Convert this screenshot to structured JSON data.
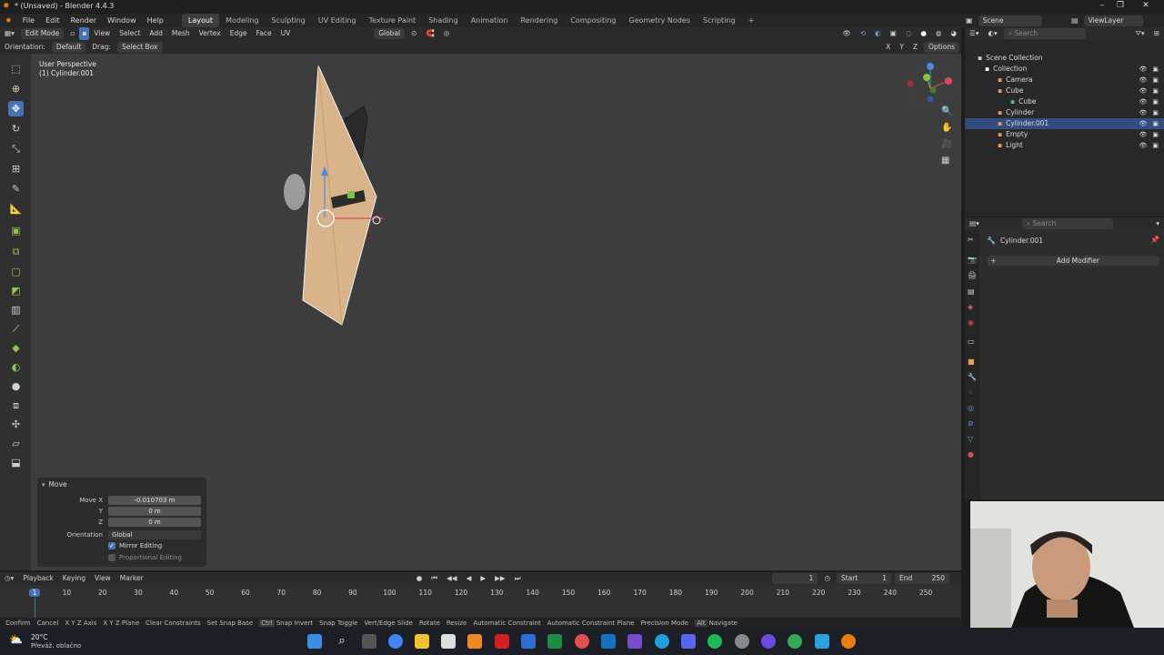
{
  "window": {
    "title": "* (Unsaved) - Blender 4.4.3"
  },
  "menu": [
    "File",
    "Edit",
    "Render",
    "Window",
    "Help"
  ],
  "workspaces": [
    "Layout",
    "Modeling",
    "Sculpting",
    "UV Editing",
    "Texture Paint",
    "Shading",
    "Animation",
    "Rendering",
    "Compositing",
    "Geometry Nodes",
    "Scripting"
  ],
  "active_workspace": "Layout",
  "scene": {
    "name": "Scene",
    "view_layer": "ViewLayer"
  },
  "viewport_header": {
    "mode": "Edit Mode",
    "menus": [
      "View",
      "Select",
      "Add",
      "Mesh",
      "Vertex",
      "Edge",
      "Face",
      "UV"
    ],
    "transform": "Global",
    "options": "Options"
  },
  "tool_header": {
    "orientation_label": "Orientation:",
    "orientation_value": "Default",
    "drag_label": "Drag:",
    "drag_value": "Select Box"
  },
  "viewport": {
    "view_name": "User Perspective",
    "object": "(1) Cylinder.001"
  },
  "move_panel": {
    "title": "Move",
    "move_x_label": "Move X",
    "move_x": "-0.010703 m",
    "y_label": "Y",
    "y": "0 m",
    "z_label": "Z",
    "z": "0 m",
    "orientation_label": "Orientation",
    "orientation": "Global",
    "mirror_editing": "Mirror Editing",
    "mirror_checked": true,
    "proportional_editing": "Proportional Editing"
  },
  "timeline": {
    "menus": [
      "Playback",
      "Keying",
      "View",
      "Marker"
    ],
    "current_frame": "1",
    "start_label": "Start",
    "start": "1",
    "end_label": "End",
    "end": "250",
    "ticks": [
      "1",
      "10",
      "20",
      "30",
      "40",
      "50",
      "60",
      "70",
      "80",
      "90",
      "100",
      "110",
      "120",
      "130",
      "140",
      "150",
      "160",
      "170",
      "180",
      "190",
      "200",
      "210",
      "220",
      "230",
      "240",
      "250"
    ]
  },
  "statusbar": [
    "Confirm",
    "Cancel",
    "X Y Z Axis",
    "X Y Z Plane",
    "Clear Constraints",
    "Set Snap Base",
    "Snap Invert",
    "Snap Toggle",
    "Vert/Edge Slide",
    "Rotate",
    "Resize",
    "Automatic Constraint",
    "Automatic Constraint Plane",
    "Precision Mode",
    "Navigate"
  ],
  "statusbar_keys": {
    "snap_invert_key": "Ctrl",
    "navigate_key": "Alt"
  },
  "outliner": {
    "search_placeholder": "Search",
    "items": [
      {
        "label": "Scene Collection",
        "icon": "collection-icon"
      },
      {
        "label": "Collection",
        "icon": "collection-icon"
      },
      {
        "label": "Camera",
        "icon": "camera-icon"
      },
      {
        "label": "Cube",
        "icon": "cube-icon"
      },
      {
        "label": "Cube",
        "icon": "mesh-icon"
      },
      {
        "label": "Cylinder",
        "icon": "cylinder-icon"
      },
      {
        "label": "Cylinder.001",
        "icon": "cylinder-icon"
      },
      {
        "label": "Empty",
        "icon": "empty-icon"
      },
      {
        "label": "Light",
        "icon": "light-icon"
      }
    ]
  },
  "properties": {
    "search_placeholder": "Search",
    "object_name": "Cylinder.001",
    "add_modifier": "Add Modifier"
  },
  "taskbar": {
    "weather_temp": "20°C",
    "weather_desc": "Převáž. oblačno"
  },
  "colors": {
    "accent": "#4772b3",
    "selection": "#334d80",
    "mesh_face": "#d9b48a",
    "x_axis": "#e0445a",
    "y_axis": "#82c43a",
    "z_axis": "#4a8ae0"
  }
}
